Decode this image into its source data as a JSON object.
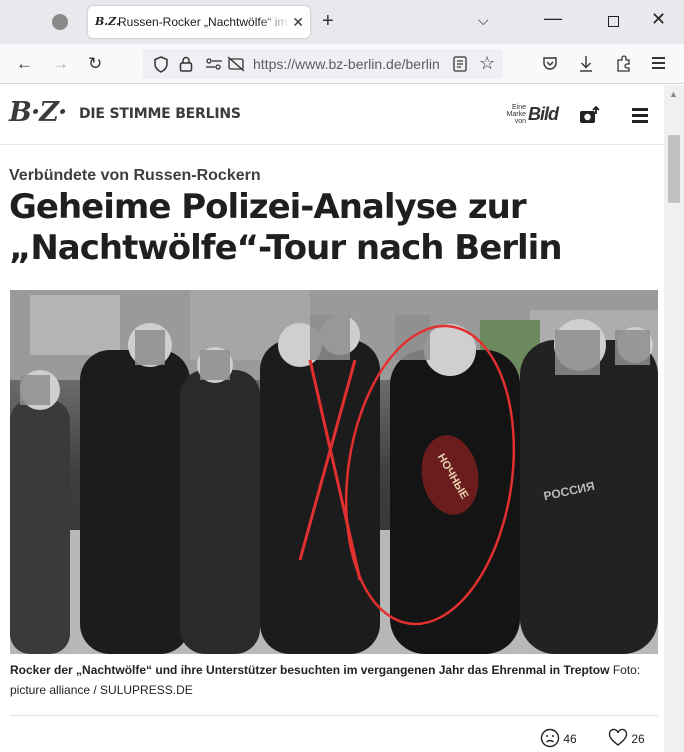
{
  "browser": {
    "tab_title": "Russen-Rocker „Nachtwölfe“ im",
    "tab_favicon_text": "B.Z.",
    "url": "https://www.bz-berlin.de/berlin"
  },
  "site": {
    "logo_text": "B·Z·",
    "slogan": "DIE STIMME BERLINS",
    "brand_small": [
      "Eine",
      "Marke",
      "von"
    ],
    "brand_name": "Bild"
  },
  "article": {
    "kicker": "Verbündete von Russen-Rockern",
    "headline": "Geheime Polizei-Analyse zur „Nachtwölfe“-Tour nach Berlin",
    "caption": "Rocker der „Nachtwölfe“ und ihre Unterstützer besuchten im vergangenen Jahr das Ehrenmal in Treptow",
    "credit_label": "Foto:",
    "credit": "picture alliance / SULUPRESS.DE",
    "patch_text": "НОЧНЫЕ",
    "patch_text_2": "РОССИЯ"
  },
  "reactions": {
    "sad_count": "46",
    "like_count": "26"
  }
}
